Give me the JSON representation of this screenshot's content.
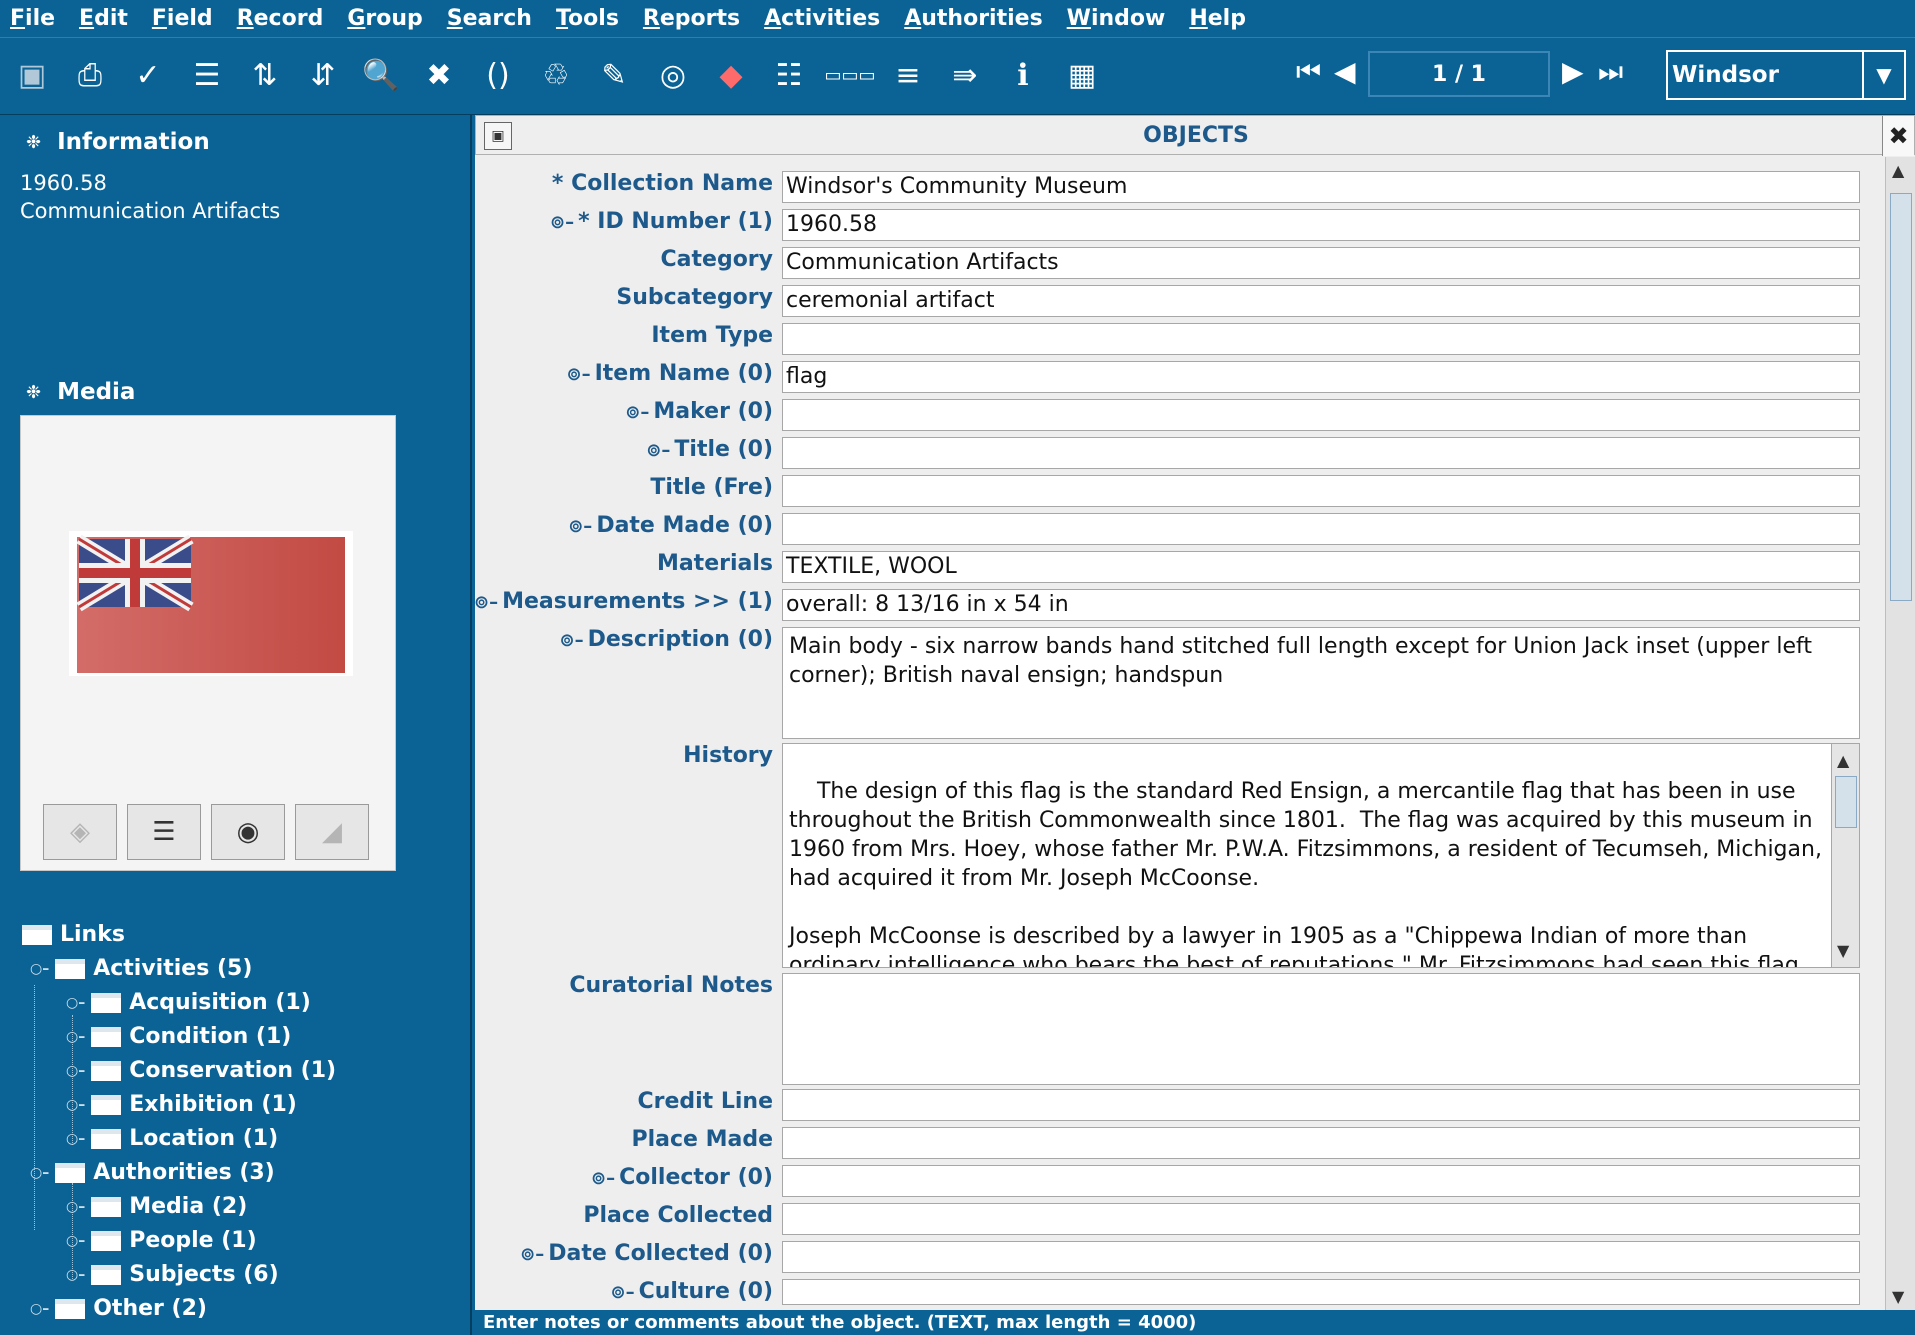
{
  "menu": [
    "File",
    "Edit",
    "Field",
    "Record",
    "Group",
    "Search",
    "Tools",
    "Reports",
    "Activities",
    "Authorities",
    "Window",
    "Help"
  ],
  "toolbar": {
    "icons": [
      "save-icon",
      "print-icon",
      "spellcheck-icon",
      "list-icon",
      "sort-ascending-icon",
      "sort-descending-icon",
      "search-icon",
      "tools-icon",
      "brackets-icon",
      "run-icon",
      "edit-note-icon",
      "target-icon",
      "eraser-icon",
      "link-icon",
      "abc-icon",
      "tree-icon",
      "forward-icon",
      "info-icon",
      "table-icon"
    ],
    "record_counter": "1 / 1",
    "site": "Windsor"
  },
  "left": {
    "information_title": "Information",
    "info_lines": [
      "1960.58",
      "Communication Artifacts"
    ],
    "media_title": "Media",
    "links_title": "Links",
    "tree": [
      {
        "label": "Activities (5)",
        "level": 1
      },
      {
        "label": "Acquisition (1)",
        "level": 2
      },
      {
        "label": "Condition (1)",
        "level": 2
      },
      {
        "label": "Conservation (1)",
        "level": 2
      },
      {
        "label": "Exhibition (1)",
        "level": 2
      },
      {
        "label": "Location (1)",
        "level": 2
      },
      {
        "label": "Authorities (3)",
        "level": 1
      },
      {
        "label": "Media (2)",
        "level": 2
      },
      {
        "label": "People (1)",
        "level": 2
      },
      {
        "label": "Subjects (6)",
        "level": 2
      },
      {
        "label": "Other (2)",
        "level": 1
      }
    ]
  },
  "objects": {
    "title": "OBJECTS",
    "fields": [
      {
        "label": "* Collection Name",
        "value": "Windsor's Community Museum",
        "link": false
      },
      {
        "label": "* ID Number (1)",
        "value": "1960.58",
        "link": true
      },
      {
        "label": "Category",
        "value": "Communication Artifacts",
        "link": false
      },
      {
        "label": "Subcategory",
        "value": "ceremonial artifact",
        "link": false
      },
      {
        "label": "Item Type",
        "value": "",
        "link": false
      },
      {
        "label": "Item Name (0)",
        "value": "flag",
        "link": true
      },
      {
        "label": "Maker (0)",
        "value": "",
        "link": true
      },
      {
        "label": "Title (0)",
        "value": "",
        "link": true
      },
      {
        "label": "Title (Fre)",
        "value": "",
        "link": false
      },
      {
        "label": "Date Made (0)",
        "value": "",
        "link": true
      },
      {
        "label": "Materials",
        "value": "TEXTILE, WOOL",
        "link": false
      },
      {
        "label": "Measurements >> (1)",
        "value": "overall: 8 13/16 in x 54 in",
        "link": true
      },
      {
        "label": "Description (0)",
        "value": "Main body - six narrow bands hand stitched full length except for Union Jack inset (upper left corner); British naval ensign; handspun",
        "link": true
      },
      {
        "label": "History",
        "value": "The design of this flag is the standard Red Ensign, a mercantile flag that has been in use throughout the British Commonwealth since 1801.  The flag was acquired by this museum in 1960 from Mrs. Hoey, whose father Mr. P.W.A. Fitzsimmons, a resident of Tecumseh, Michigan, had acquired it from Mr. Joseph McCoonse.\n\nJoseph McCoonse is described by a lawyer in 1905 as a \"Chippewa Indian of more than ordinary intelligence who bears the best of reputations.\" Mr. Fitzsimmons had seen this flag on display in the Indian Territory building at the 1904 St. Louis' World Fair.  Mr. McCoonse's father was Ash-ton-quat",
        "link": false
      },
      {
        "label": "Curatorial Notes",
        "value": "",
        "link": false
      },
      {
        "label": "Credit Line",
        "value": "",
        "link": false
      },
      {
        "label": "Place Made",
        "value": "",
        "link": false
      },
      {
        "label": "Collector (0)",
        "value": "",
        "link": true
      },
      {
        "label": "Place Collected",
        "value": "",
        "link": false
      },
      {
        "label": "Date Collected (0)",
        "value": "",
        "link": true
      },
      {
        "label": "Culture (0)",
        "value": "",
        "link": true
      }
    ]
  },
  "status": "Enter notes or comments about the object. (TEXT, max length = 4000)",
  "colors": {
    "panel": "#0b6395",
    "label": "#1d5a8b",
    "form_bg": "#eeeeee"
  }
}
